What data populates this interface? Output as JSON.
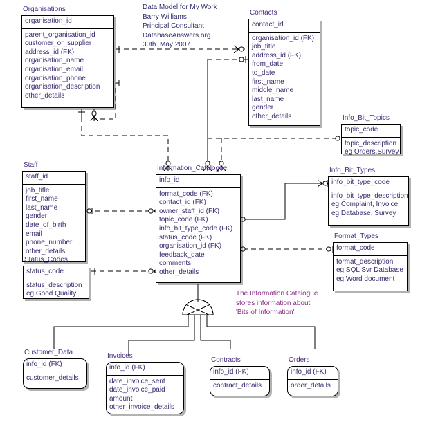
{
  "diagram": {
    "title_block": {
      "lines": [
        "Data Model for My Work",
        "Barry Williams",
        "Principal Consultant",
        "DatabaseAnswers.org",
        "30th. May 2007"
      ]
    },
    "annotation": {
      "lines": [
        "The Information Catalogue",
        "stores information about",
        "'Bits of Information'"
      ]
    },
    "colors": {
      "entity_text": "#3c2a6e",
      "entity_title": "#4b2d7f",
      "header_text": "#2b2b6b",
      "annotation_text": "#8a2f8a",
      "line": "#000000",
      "background": "#ffffff"
    },
    "entities": [
      {
        "name": "Organisations",
        "pk": [
          "organisation_id"
        ],
        "attributes": [
          "parent_organisation_id",
          "customer_or_supplier",
          "address_id (FK)",
          "organisation_name",
          "organisation_email",
          "organisation_phone",
          "organisation_description",
          "other_details"
        ]
      },
      {
        "name": "Contacts",
        "pk": [
          "contact_id"
        ],
        "attributes": [
          "organisation_id (FK)",
          "job_title",
          "address_id (FK)",
          "from_date",
          "to_date",
          "first_name",
          "middle_name",
          "last_name",
          "gender",
          "other_details"
        ]
      },
      {
        "name": "Info_Bit_Topics",
        "pk": [
          "topic_code"
        ],
        "attributes": [
          "topic_description",
          "eg Orders,Survey"
        ]
      },
      {
        "name": "Staff",
        "pk": [
          "staff_id"
        ],
        "attributes": [
          "job_title",
          "first_name",
          "last_name",
          "gender",
          "date_of_birth",
          "email",
          "phone_number",
          "other_details"
        ]
      },
      {
        "name": "Information_Catalogue",
        "pk": [
          "info_id"
        ],
        "attributes": [
          "format_code (FK)",
          "contact_id (FK)",
          "owner_staff_id (FK)",
          "topic_code (FK)",
          "info_bit_type_code (FK)",
          "status_code (FK)",
          "organisation_id (FK)",
          "feedback_date",
          "comments",
          "other_details"
        ]
      },
      {
        "name": "Info_Bit_Types",
        "pk": [
          "info_bit_type_code"
        ],
        "attributes": [
          "info_bit_type_description",
          "eg Complaint, Invoice",
          "eg Database, Survey"
        ]
      },
      {
        "name": "Format_Types",
        "pk": [
          "format_code"
        ],
        "attributes": [
          "format_description",
          "eg SQL Svr Database",
          "eg Word document"
        ]
      },
      {
        "name": "Status_Codes",
        "pk": [
          "status_code"
        ],
        "attributes": [
          "status_description",
          "eg Good Quality"
        ]
      },
      {
        "name": "Customer_Data",
        "pk": [
          "info_id (FK)"
        ],
        "attributes": [
          "customer_details"
        ]
      },
      {
        "name": "Invoices",
        "pk": [
          "info_id (FK)"
        ],
        "attributes": [
          "date_invoice_sent",
          "date_invoice_paid",
          "amount",
          "other_invoice_details"
        ]
      },
      {
        "name": "Contracts",
        "pk": [
          "info_id (FK)"
        ],
        "attributes": [
          "contract_details"
        ]
      },
      {
        "name": "Orders",
        "pk": [
          "info_id (FK)"
        ],
        "attributes": [
          "order_details"
        ]
      }
    ]
  }
}
